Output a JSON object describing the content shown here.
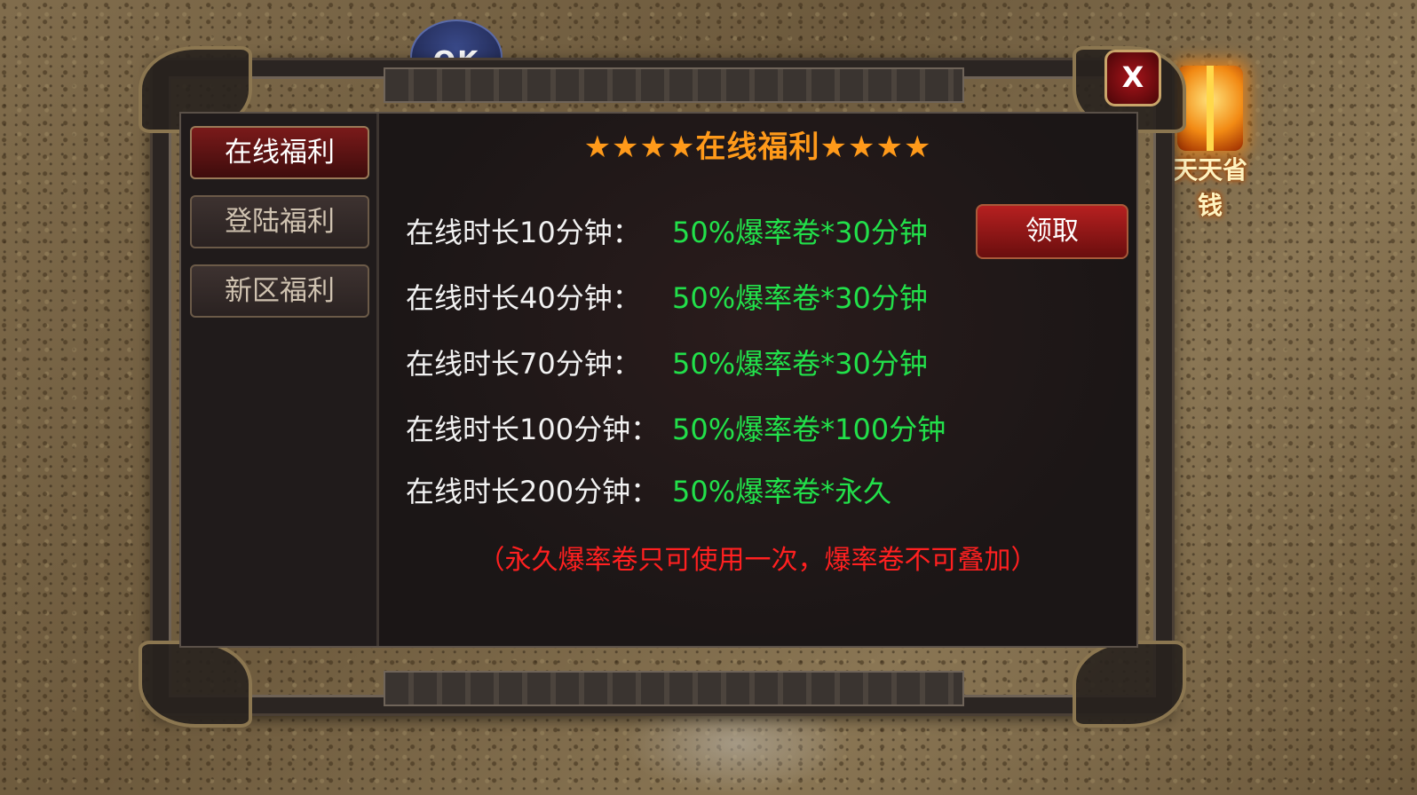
{
  "badge": {
    "ok_text": "OK"
  },
  "gift_widget": {
    "label": "天天省钱",
    "icon": "gift-icon"
  },
  "dialog": {
    "title": "★★★★在线福利★★★★",
    "close_label": "X",
    "tabs": [
      {
        "label": "在线福利",
        "active": true
      },
      {
        "label": "登陆福利",
        "active": false
      },
      {
        "label": "新区福利",
        "active": false
      }
    ],
    "rows": [
      {
        "label": "在线时长10分钟：",
        "reward": "50%爆率卷*30分钟"
      },
      {
        "label": "在线时长40分钟：",
        "reward": "50%爆率卷*30分钟"
      },
      {
        "label": "在线时长70分钟：",
        "reward": "50%爆率卷*30分钟"
      },
      {
        "label": "在线时长100分钟：",
        "reward": "50%爆率卷*100分钟"
      },
      {
        "label": "在线时长200分钟：",
        "reward": "50%爆率卷*永久"
      }
    ],
    "claim_label": "领取",
    "notice": "（永久爆率卷只可使用一次，爆率卷不可叠加）"
  },
  "colors": {
    "title": "#ff9a1a",
    "reward": "#22e04a",
    "notice": "#ff2020",
    "active_tab": "#7a1a1a"
  }
}
